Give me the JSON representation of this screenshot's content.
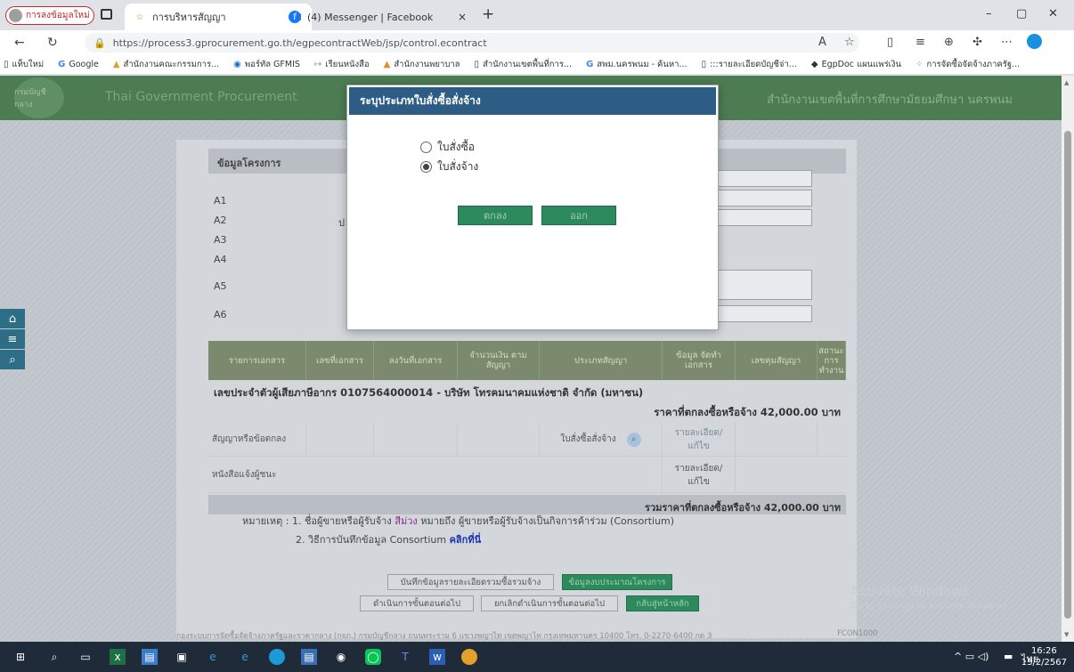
{
  "browser": {
    "profile_label": "การลงข้อมูลใหม่",
    "tabs": [
      {
        "title": "การบริหารสัญญา",
        "close": "×"
      },
      {
        "title": "(4) Messenger | Facebook",
        "close": "×"
      }
    ],
    "new_tab": "+",
    "window_controls": [
      "–",
      "▢",
      "✕"
    ],
    "url": "https://process3.gprocurement.go.th/egpecontractWeb/jsp/control.econtract",
    "favorites": [
      "แท็บใหม่",
      "Google",
      "สำนักงานคณะกรรมการ...",
      "พอร์ทัล GFMIS",
      "เรียนหนังสือ",
      "สำนักงานพยาบาล",
      "สำนักงานเขตพื้นที่การ...",
      "สพม.นครพนม - ค้นหา...",
      ":::รายละเอียดบัญชีจ่า...",
      "EgpDoc แผนแพร่เงิน",
      "การจัดซื้อจัดจ้างภาครัฐ..."
    ]
  },
  "site": {
    "header_left": "Thai Government Procurement",
    "header_right": "สำนักงานเขตพื้นที่การศึกษามัธยมศึกษา นครพนม",
    "seal_text": "กรมบัญชีกลาง"
  },
  "project_section": {
    "title": "ข้อมูลโครงการ",
    "labels": [
      "A1",
      "A2",
      "A3",
      "A4",
      "A5",
      "A6"
    ],
    "a2_prefix": "ป"
  },
  "table": {
    "headers": [
      "รายการเอกสาร",
      "เลขที่เอกสาร",
      "ลงวันที่เอกสาร",
      "จำนวนเงิน ตามสัญญา",
      "ประเภทสัญญา",
      "ข้อมูล จัดทำเอกสาร",
      "เลขคุมสัญญา",
      "สถานะ การ ทำงาน"
    ],
    "vendor_line": "เลขประจำตัวผู้เสียภาษีอากร 0107564000014 - บริษัท โทรคมนาคมแห่งชาติ จำกัด (มหาชน)",
    "agreed_price": "ราคาที่ตกลงซื้อหรือจ้าง 42,000.00 บาท",
    "rows": [
      {
        "doc": "สัญญาหรือข้อตกลง",
        "type": "ใบสั่งซื้อสั่งจ้าง",
        "action": "รายละเอียด/แก้ไข"
      },
      {
        "doc": "หนังสือแจ้งผู้ชนะ",
        "type": "",
        "action": "รายละเอียด/แก้ไข"
      }
    ],
    "total": "รวมราคาที่ตกลงซื้อหรือจ้าง 42,000.00 บาท"
  },
  "notes": {
    "line1_prefix": "หมายเหตุ : 1. ชื่อผู้ขายหรือผู้รับจ้าง ",
    "line1_purple": "สีม่วง",
    "line1_suffix": " หมายถึง ผู้ขายหรือผู้รับจ้างเป็นกิจการค้าร่วม (Consortium)",
    "line2_prefix": "2. วิธีการบันทึกข้อมูล Consortium ",
    "line2_link": "คลิกที่นี่"
  },
  "page_buttons": {
    "save_summary": "บันทึกข้อมูลรายละเอียดรวมซื้อรวมจ้าง",
    "budget_info": "ข้อมูลงบประมาณโครงการ",
    "next_step": "ดำเนินการขั้นตอนต่อไป",
    "cancel_step": "ยกเลิกดำเนินการขั้นตอนต่อไป",
    "home": "กลับสู่หน้าหลัก"
  },
  "footer": {
    "text": "กองระบบการจัดซื้อจัดจ้างภาครัฐและราคากลาง (กจภ.) กรมบัญชีกลาง ถนนพระราม 6 แขวงพญาไท เขตพญาไท กรุงเทพมหานคร 10400 โทร. 0-2270-6400 กด 3",
    "code": "FCON1000"
  },
  "activate": {
    "title": "Activate Windows",
    "subtitle": "Go to Settings to activate Windows."
  },
  "modal": {
    "title": "ระบุประเภทใบสั่งซื้อสั่งจ้าง",
    "options": [
      {
        "label": "ใบสั่งซื้อ",
        "selected": false
      },
      {
        "label": "ใบสั่งจ้าง",
        "selected": true
      }
    ],
    "ok": "ตกลง",
    "exit": "ออก"
  },
  "taskbar": {
    "time": "16:26",
    "date": "13/2/2567",
    "lang": "ไทย"
  }
}
